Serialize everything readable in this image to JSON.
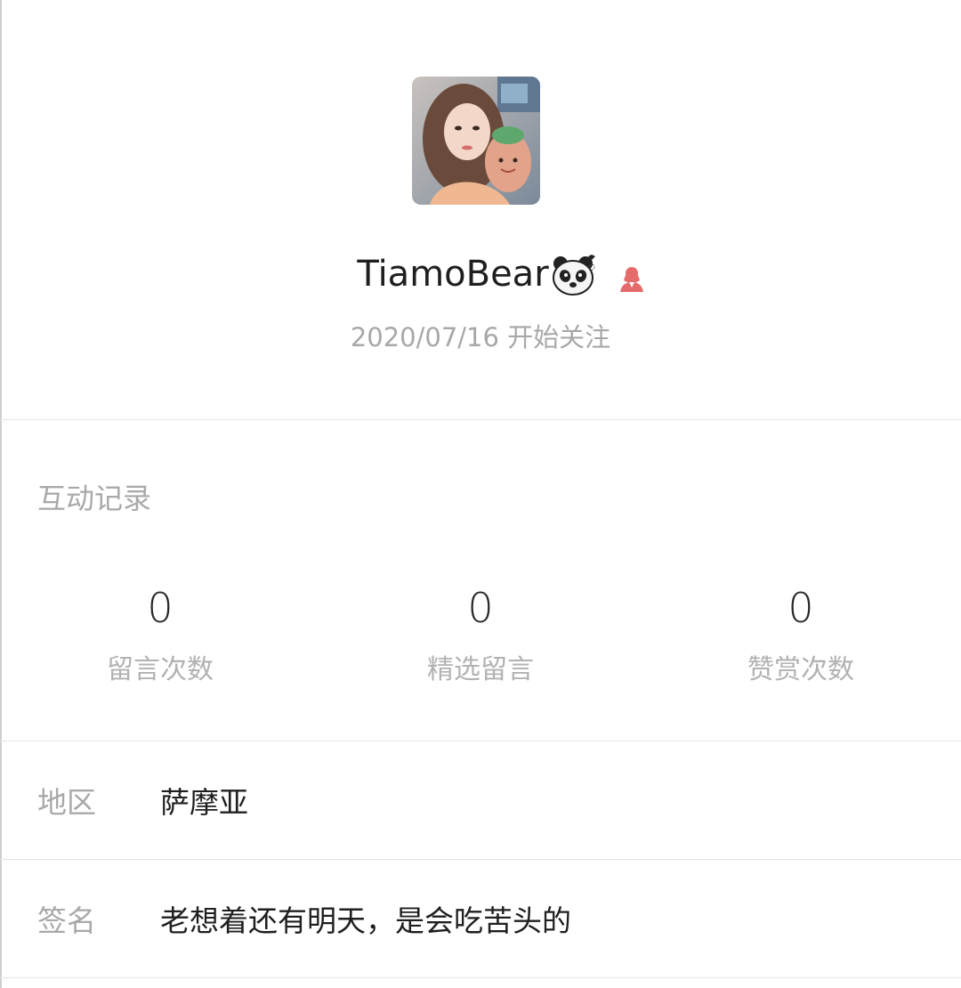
{
  "profile": {
    "nickname": "TiamoBear",
    "avatar_icon": "avatar-photo",
    "badge_icon": "panda-emoji-icon",
    "gender_icon": "female-user-icon",
    "follow_date": "2020/07/16 开始关注",
    "colors": {
      "gender_icon": "#e56b6b",
      "muted_text": "#a9a9a9",
      "primary_text": "#1f1f1f"
    }
  },
  "interaction": {
    "title": "互动记录",
    "stats": [
      {
        "value": "0",
        "label": "留言次数"
      },
      {
        "value": "0",
        "label": "精选留言"
      },
      {
        "value": "0",
        "label": "赞赏次数"
      }
    ]
  },
  "info": {
    "region": {
      "label": "地区",
      "value": "萨摩亚"
    },
    "signature": {
      "label": "签名",
      "value": "老想着还有明天，是会吃苦头的"
    }
  }
}
